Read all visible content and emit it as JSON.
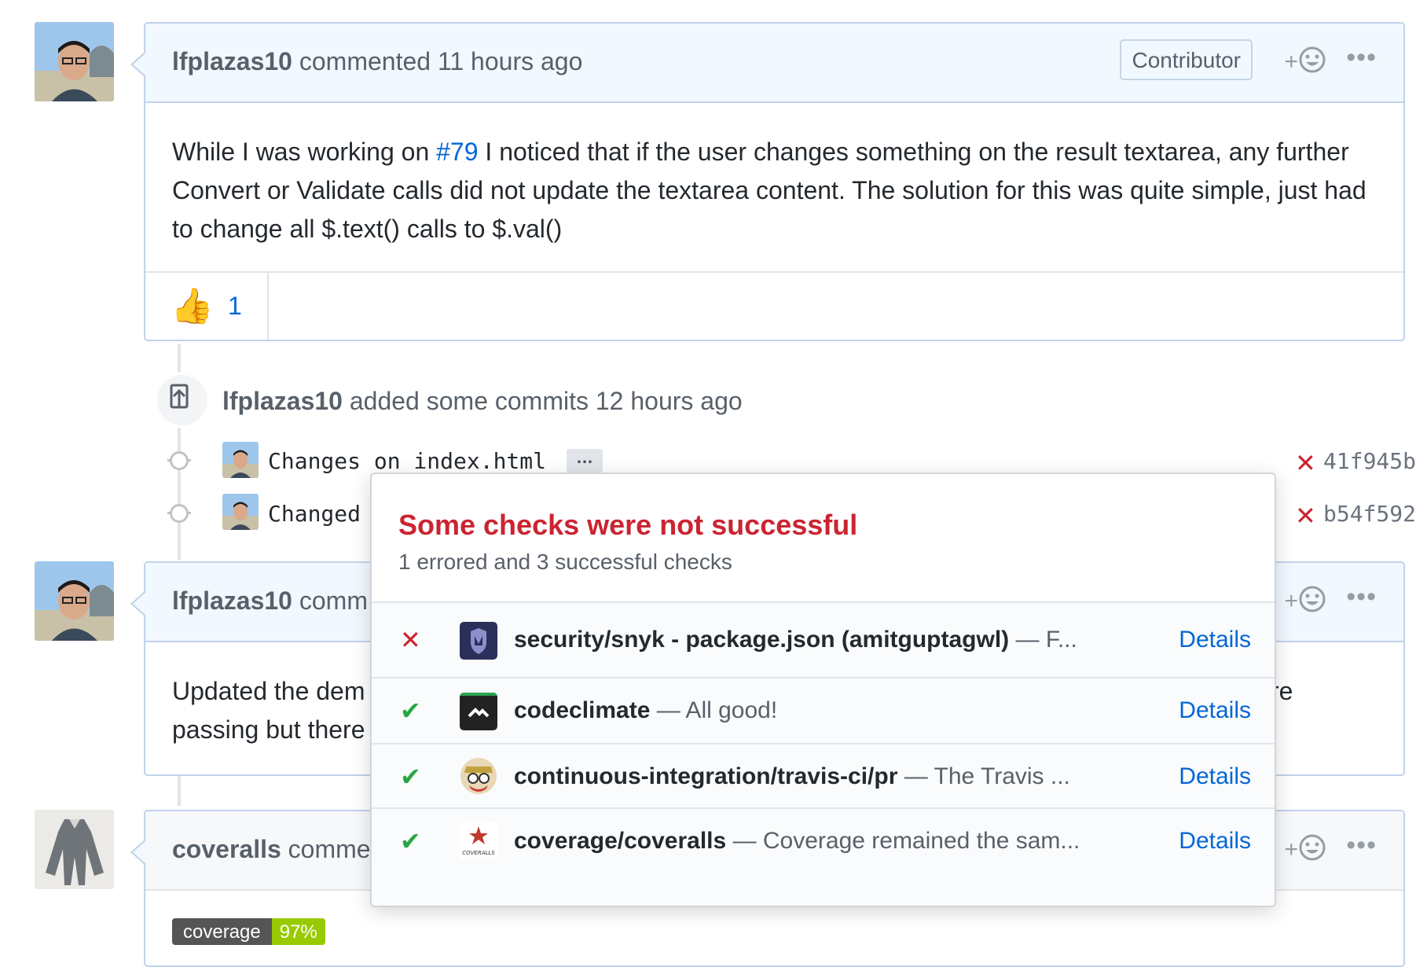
{
  "comments": [
    {
      "author": "lfplazas10",
      "action": "commented 11 hours ago",
      "badge": "Contributor",
      "body_pre": "While I was working on ",
      "body_link": "#79",
      "body_post": " I noticed that if the user changes something on the result textarea, any further Convert or Validate calls did not update the textarea content. The solution for this was quite simple, just had to change all $.text() calls to $.val()",
      "reaction_count": "1"
    },
    {
      "author": "lfplazas10",
      "action_partial": "comm",
      "body_line1": "Updated the dem",
      "body_line1_tail": "re",
      "body_line2": "passing but there"
    },
    {
      "author": "coveralls",
      "action_partial": "comme"
    }
  ],
  "react_plus": "+",
  "more_label": "•••",
  "event": {
    "author": "lfplazas10",
    "action": "added some commits 12 hours ago",
    "commits": [
      {
        "message": "Changes on index.html",
        "sha": "41f945b",
        "status": "✕"
      },
      {
        "message": "Changed",
        "sha": "b54f592",
        "status": "✕"
      }
    ],
    "ellipsis": "…"
  },
  "coverage_badge": {
    "label": "coverage",
    "value": "97%"
  },
  "popover": {
    "title": "Some checks were not successful",
    "subtitle": "1 errored and 3 successful checks",
    "details_label": "Details",
    "checks": [
      {
        "status": "✕",
        "status_color": "#cb2431",
        "name": "security/snyk - package.json (amitguptagwl)",
        "desc": " — F..."
      },
      {
        "status": "✔",
        "status_color": "#28a745",
        "name": "codeclimate",
        "desc": " — All good!"
      },
      {
        "status": "✔",
        "status_color": "#28a745",
        "name": "continuous-integration/travis-ci/pr",
        "desc": " — The Travis ..."
      },
      {
        "status": "✔",
        "status_color": "#28a745",
        "name": "coverage/coveralls",
        "desc": " — Coverage remained the sam..."
      }
    ],
    "coveralls_logo_text": "COVERALLS"
  }
}
